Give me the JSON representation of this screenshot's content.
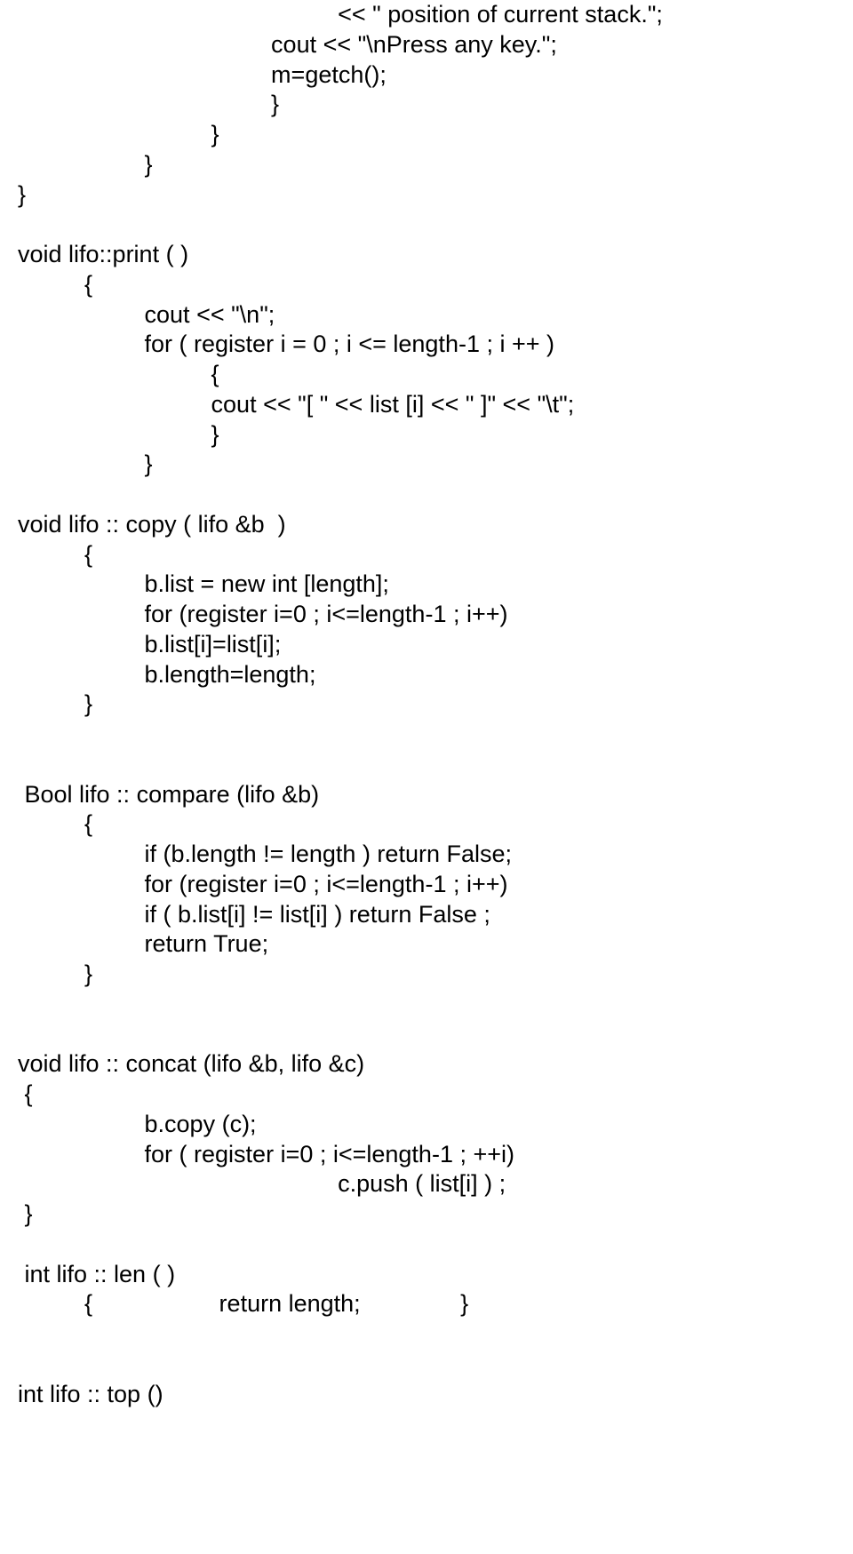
{
  "lines": [
    "                                                << \" position of current stack.\";",
    "                                      cout << \"\\nPress any key.\";",
    "                                      m=getch();",
    "                                      }",
    "                             }",
    "                   }",
    "}",
    "",
    "void lifo::print ( )",
    "          {",
    "                   cout << \"\\n\";",
    "                   for ( register i = 0 ; i <= length-1 ; i ++ )",
    "                             {",
    "                             cout << \"[ \" << list [i] << \" ]\" << \"\\t\";",
    "                             }",
    "                   }",
    "",
    "void lifo :: copy ( lifo &b  )",
    "          {",
    "                   b.list = new int [length];",
    "                   for (register i=0 ; i<=length-1 ; i++)",
    "                   b.list[i]=list[i];",
    "                   b.length=length;",
    "          }",
    "",
    "",
    " Bool lifo :: compare (lifo &b)",
    "          {",
    "                   if (b.length != length ) return False;",
    "                   for (register i=0 ; i<=length-1 ; i++)",
    "                   if ( b.list[i] != list[i] ) return False ;",
    "                   return True;",
    "          }",
    "",
    "",
    "void lifo :: concat (lifo &b, lifo &c)",
    " {",
    "                   b.copy (c);",
    "                   for ( register i=0 ; i<=length-1 ; ++i)",
    "                                                c.push ( list[i] ) ;",
    " }",
    "",
    " int lifo :: len ( )",
    "          {                   return length;               }",
    "",
    "",
    "int lifo :: top ()"
  ]
}
